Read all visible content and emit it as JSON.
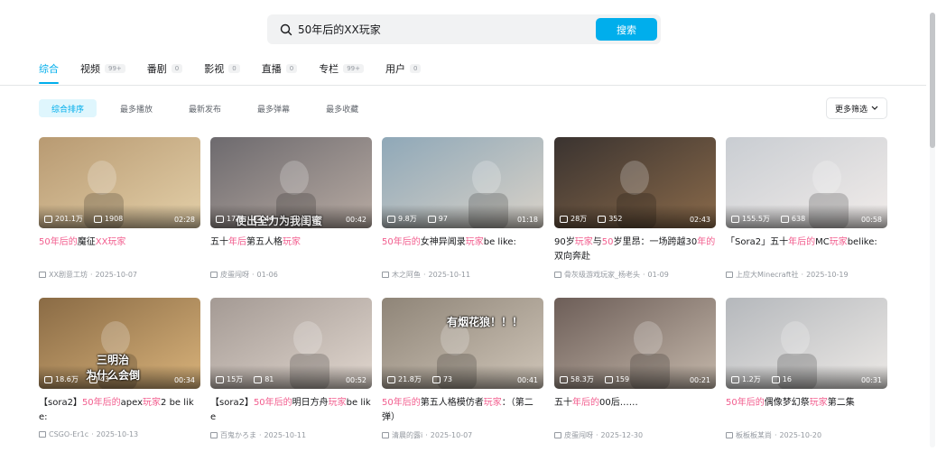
{
  "search": {
    "value": "50年后的XX玩家",
    "button": "搜索"
  },
  "tabs": [
    {
      "label": "综合",
      "count": ""
    },
    {
      "label": "视频",
      "count": "99+"
    },
    {
      "label": "番剧",
      "count": "0"
    },
    {
      "label": "影视",
      "count": "0"
    },
    {
      "label": "直播",
      "count": "0"
    },
    {
      "label": "专栏",
      "count": "99+"
    },
    {
      "label": "用户",
      "count": "0"
    }
  ],
  "sorts": [
    "综合排序",
    "最多播放",
    "最新发布",
    "最多弹幕",
    "最多收藏"
  ],
  "more_filter": "更多筛选",
  "videos": [
    {
      "plays": "201.1万",
      "danmaku": "1908",
      "duration": "02:28",
      "title": [
        [
          "hl",
          "50年后的"
        ],
        [
          "",
          "魔征"
        ],
        [
          "hl",
          "XX玩家"
        ]
      ],
      "uploader": "XX剧意工坊",
      "date": "2025-10-07",
      "overlay": ""
    },
    {
      "plays": "17万",
      "danmaku": "44",
      "duration": "00:42",
      "title": [
        [
          "",
          "五十"
        ],
        [
          "hl",
          "年后"
        ],
        [
          "",
          "第五人格"
        ],
        [
          "hl",
          "玩家"
        ]
      ],
      "uploader": "皮蛋闯呀",
      "date": "01-06",
      "overlay": "使出全力为我闺蜜"
    },
    {
      "plays": "9.8万",
      "danmaku": "97",
      "duration": "01:18",
      "title": [
        [
          "hl",
          "50年后的"
        ],
        [
          "",
          "女神异闻录"
        ],
        [
          "hl",
          "玩家"
        ],
        [
          "",
          "be like:"
        ]
      ],
      "uploader": "木之阿鱼",
      "date": "2025-10-11",
      "overlay": ""
    },
    {
      "plays": "28万",
      "danmaku": "352",
      "duration": "02:43",
      "title": [
        [
          "",
          "90岁"
        ],
        [
          "hl",
          "玩家"
        ],
        [
          "",
          "与"
        ],
        [
          "hl",
          "50"
        ],
        [
          "",
          "岁里昂：一场跨越30"
        ],
        [
          "hl",
          "年的"
        ],
        [
          "",
          "双向奔赴"
        ]
      ],
      "uploader": "骨灰级游戏玩家_杨老头",
      "date": "01-09",
      "overlay": ""
    },
    {
      "plays": "155.5万",
      "danmaku": "638",
      "duration": "00:58",
      "title": [
        [
          "",
          "「Sora2」五十"
        ],
        [
          "hl",
          "年后的"
        ],
        [
          "",
          "MC"
        ],
        [
          "hl",
          "玩家"
        ],
        [
          "",
          "belike:"
        ]
      ],
      "uploader": "上应大Minecraft社",
      "date": "2025-10-19",
      "overlay": ""
    },
    {
      "plays": "18.6万",
      "danmaku": "43",
      "duration": "00:34",
      "title": [
        [
          "",
          "【sora2】"
        ],
        [
          "hl",
          "50年后的"
        ],
        [
          "",
          "apex"
        ],
        [
          "hl",
          "玩家"
        ],
        [
          "",
          "2 be like:"
        ]
      ],
      "uploader": "CSGO-Er1c",
      "date": "2025-10-13",
      "overlay": "三明治\n为什么会倒"
    },
    {
      "plays": "15万",
      "danmaku": "81",
      "duration": "00:52",
      "title": [
        [
          "",
          "【sora2】"
        ],
        [
          "hl",
          "50年后的"
        ],
        [
          "",
          "明日方舟"
        ],
        [
          "hl",
          "玩家"
        ],
        [
          "",
          "be like"
        ]
      ],
      "uploader": "百鬼かろま",
      "date": "2025-10-11",
      "overlay": ""
    },
    {
      "plays": "21.8万",
      "danmaku": "73",
      "duration": "00:41",
      "title": [
        [
          "hl",
          "50年后的"
        ],
        [
          "",
          "第五人格模仿者"
        ],
        [
          "hl",
          "玩家"
        ],
        [
          "",
          "：（第二弹）"
        ]
      ],
      "uploader": "清晨的露i",
      "date": "2025-10-07",
      "overlay": "有烟花狼！！！"
    },
    {
      "plays": "58.3万",
      "danmaku": "159",
      "duration": "00:21",
      "title": [
        [
          "",
          "五十"
        ],
        [
          "hl",
          "年后的"
        ],
        [
          "",
          "00后……"
        ]
      ],
      "uploader": "皮蛋闯呀",
      "date": "2025-12-30",
      "overlay": ""
    },
    {
      "plays": "1.2万",
      "danmaku": "16",
      "duration": "00:31",
      "title": [
        [
          "hl",
          "50年后的"
        ],
        [
          "",
          "偶像梦幻祭"
        ],
        [
          "hl",
          "玩家"
        ],
        [
          "",
          "第二集"
        ]
      ],
      "uploader": "板板板某尚",
      "date": "2025-10-20",
      "overlay": ""
    }
  ],
  "thumb_colors": [
    [
      "#b89a72",
      "#e3cfa8"
    ],
    [
      "#6d6a6e",
      "#b7aaa2"
    ],
    [
      "#8fa8b8",
      "#d9d2c8"
    ],
    [
      "#3a3330",
      "#8a6a4a"
    ],
    [
      "#c9cdd2",
      "#f1ecea"
    ],
    [
      "#8a6b45",
      "#d8b27a"
    ],
    [
      "#a49a94",
      "#e0d6ce"
    ],
    [
      "#8f8578",
      "#cfc5b8"
    ],
    [
      "#6d5e58",
      "#c4b7aa"
    ],
    [
      "#b5b8bc",
      "#ece9e6"
    ]
  ],
  "accent": "#00aeec",
  "highlight": "#f25d8e"
}
